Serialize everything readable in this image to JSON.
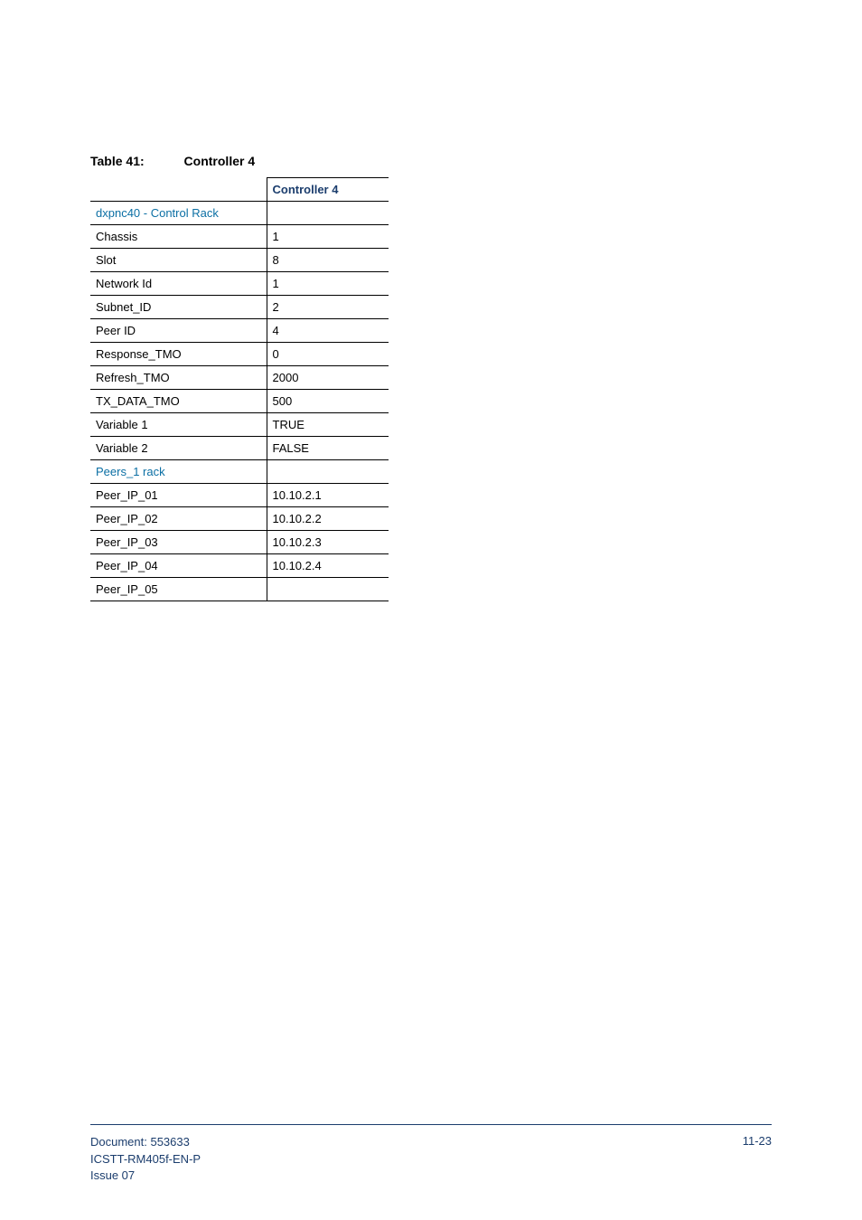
{
  "caption": {
    "label": "Table 41:",
    "title": "Controller 4"
  },
  "table": {
    "header": {
      "c1": "",
      "c2": "Controller 4"
    },
    "rows": [
      {
        "c1": "dxpnc40   - Control Rack",
        "c2": "",
        "section": true
      },
      {
        "c1": "Chassis",
        "c2": "1"
      },
      {
        "c1": "Slot",
        "c2": "8"
      },
      {
        "c1": "Network Id",
        "c2": "1"
      },
      {
        "c1": "Subnet_ID",
        "c2": "2"
      },
      {
        "c1": "Peer ID",
        "c2": "4"
      },
      {
        "c1": "Response_TMO",
        "c2": "0"
      },
      {
        "c1": "Refresh_TMO",
        "c2": "2000"
      },
      {
        "c1": "TX_DATA_TMO",
        "c2": "500"
      },
      {
        "c1": "Variable 1",
        "c2": "TRUE"
      },
      {
        "c1": "Variable 2",
        "c2": "FALSE"
      },
      {
        "c1": "Peers_1 rack",
        "c2": "",
        "section": true
      },
      {
        "c1": "Peer_IP_01",
        "c2": "10.10.2.1"
      },
      {
        "c1": "Peer_IP_02",
        "c2": "10.10.2.2"
      },
      {
        "c1": "Peer_IP_03",
        "c2": "10.10.2.3"
      },
      {
        "c1": "Peer_IP_04",
        "c2": "10.10.2.4"
      },
      {
        "c1": "Peer_IP_05",
        "c2": ""
      }
    ]
  },
  "footer": {
    "doc_line1": "Document: 553633",
    "doc_line2": "ICSTT-RM405f-EN-P",
    "doc_line3": " Issue 07",
    "page": "11-23"
  }
}
